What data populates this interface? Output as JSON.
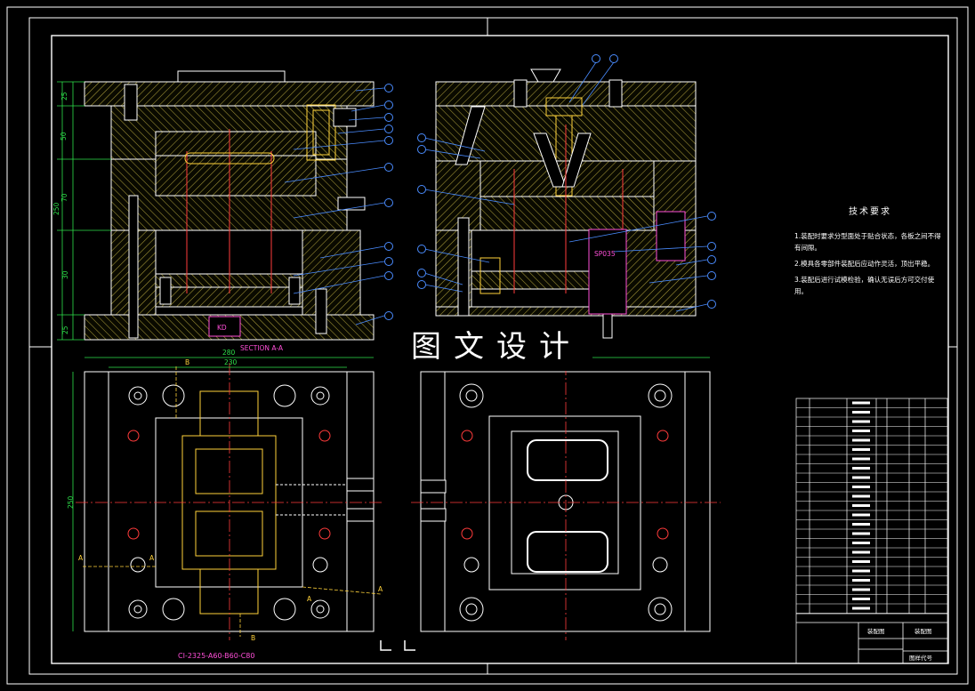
{
  "drawing": {
    "section_label": "SECTION A-A",
    "kd_label": "KD",
    "sp_label": "SP035",
    "watermark": "图文设计",
    "standard_code": "CI-2325-A60-B60-C80",
    "dims_left": [
      "25",
      "50",
      "70",
      "30",
      "25"
    ],
    "dim_total_height": "250",
    "dim_width_outer": "280",
    "dim_width_inner": "230",
    "dim_plan_height": "250",
    "section_marks": [
      "A",
      "A",
      "A",
      "A",
      "B",
      "B"
    ]
  },
  "notes": {
    "title": "技术要求",
    "items": [
      "1.装配时要求分型面处于贴合状态，各板之间不得有间隙。",
      "2.模具各零部件装配后应动作灵活，顶出平稳。",
      "3.装配后进行试模检验，确认无误后方可交付使用。"
    ]
  },
  "title_block": {
    "label_left": "装配图",
    "label_right": "装配图",
    "label_code": "图样代号"
  },
  "colors": {
    "hatch": "#a89a3a",
    "frame": "#ffffff",
    "callout": "#4a8cff",
    "center": "#ff3b3b",
    "dim": "#00d0e0",
    "part": "#ffd23a",
    "green": "#2ee04a",
    "magenta": "#ff4fd8"
  }
}
